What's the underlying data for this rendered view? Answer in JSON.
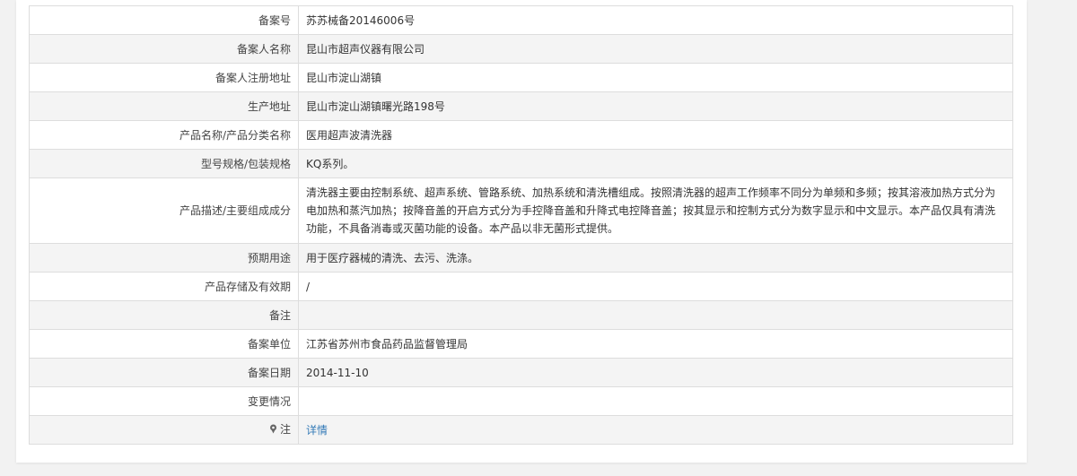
{
  "record": {
    "rows": [
      {
        "label": "备案号",
        "value": "苏苏械备20146006号"
      },
      {
        "label": "备案人名称",
        "value": "昆山市超声仪器有限公司"
      },
      {
        "label": "备案人注册地址",
        "value": "昆山市淀山湖镇"
      },
      {
        "label": "生产地址",
        "value": "昆山市淀山湖镇曙光路198号"
      },
      {
        "label": "产品名称/产品分类名称",
        "value": "医用超声波清洗器"
      },
      {
        "label": "型号规格/包装规格",
        "value": "KQ系列。"
      },
      {
        "label": "产品描述/主要组成成分",
        "value": "清洗器主要由控制系统、超声系统、管路系统、加热系统和清洗槽组成。按照清洗器的超声工作频率不同分为单频和多频；按其溶液加热方式分为电加热和蒸汽加热；按降音盖的开启方式分为手控降音盖和升降式电控降音盖；按其显示和控制方式分为数字显示和中文显示。本产品仅具有清洗功能，不具备消毒或灭菌功能的设备。本产品以非无菌形式提供。"
      },
      {
        "label": "预期用途",
        "value": "用于医疗器械的清洗、去污、洗涤。"
      },
      {
        "label": "产品存储及有效期",
        "value": "/"
      },
      {
        "label": "备注",
        "value": ""
      },
      {
        "label": "备案单位",
        "value": "江苏省苏州市食品药品监督管理局"
      },
      {
        "label": "备案日期",
        "value": "2014-11-10"
      },
      {
        "label": "变更情况",
        "value": ""
      }
    ],
    "note": {
      "label": "注",
      "icon": "pin-icon",
      "link_text": "详情"
    }
  }
}
